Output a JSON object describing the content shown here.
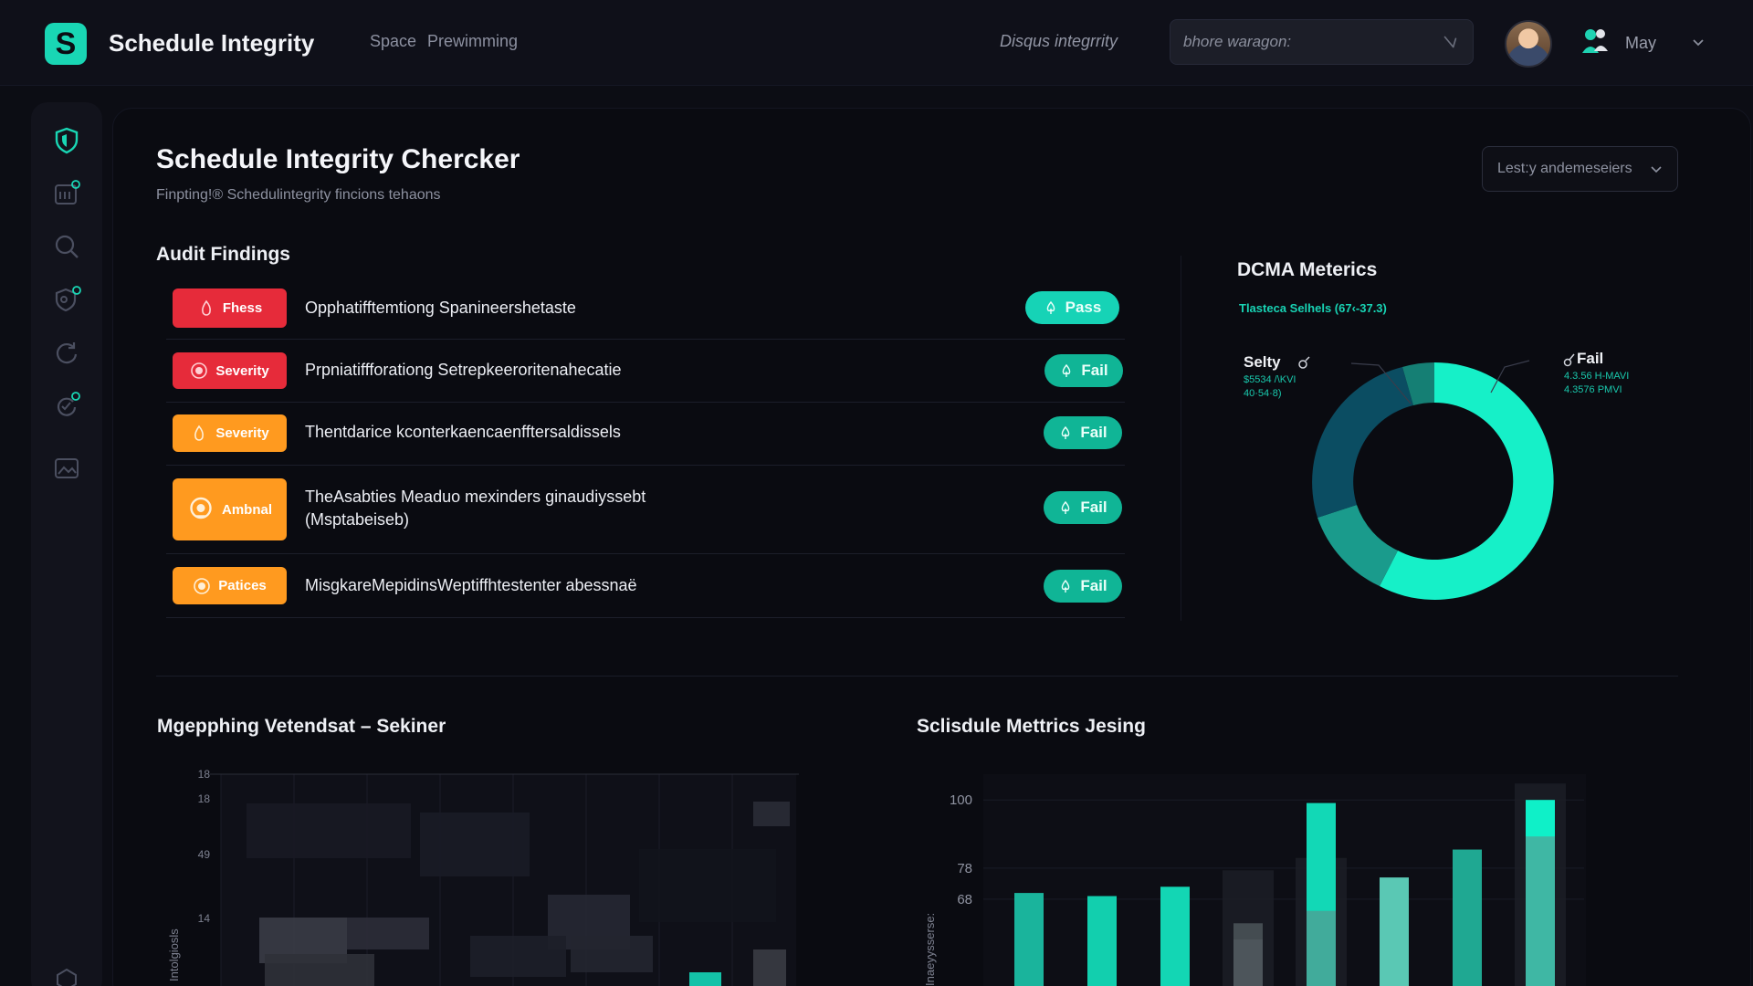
{
  "header": {
    "logo_letter": "S",
    "app_title": "Schedule Integrity",
    "nav": [
      "Space",
      "Prewimming"
    ],
    "top_link": "Disqus integrrity",
    "search_placeholder": "bhore waragon:",
    "user_name": "May"
  },
  "page": {
    "title": "Schedule Integrity Chercker",
    "subtitle": "Finpting!® Schedulintegrity fincions tehaons",
    "filter_label": "Lest:y andemeseiers"
  },
  "audit": {
    "title": "Audit Findings",
    "findings": [
      {
        "severity": "Fhess",
        "severity_color": "#e62b3a",
        "text_lines": [
          "Opphatifftemtiong Spanineershetaste"
        ],
        "status": "Pass"
      },
      {
        "severity": "Severity",
        "severity_color": "#e62b3a",
        "text_lines": [
          "Prpniatiffforationg Setrepkeeroritenahecatie"
        ],
        "status": "Fail"
      },
      {
        "severity": "Severity",
        "severity_color": "#ff9a1f",
        "text_lines": [
          "Thentdarice kconterkaencaenfftersaldissels"
        ],
        "status": "Fail"
      },
      {
        "severity": "Ambnal",
        "severity_color": "#ff9a1f",
        "text_lines": [
          "TheAsabties Meaduo mexinders ginaudiyssebt",
          "(Msptabeiseb)"
        ],
        "status": "Fail"
      },
      {
        "severity": "Patices",
        "severity_color": "#ff9a1f",
        "text_lines": [
          "MisgkareMepidinsWeptiffhtestenter abessnaë"
        ],
        "status": "Fail"
      }
    ]
  },
  "dcma": {
    "title": "DCMA Meterics",
    "subtitle": "Tlasteca Selhels (67‹-37.3)",
    "legend": [
      {
        "label": "Selty",
        "lines": [
          "$5534 /\\KVI",
          "40·54·8)"
        ]
      },
      {
        "label": "Fail",
        "lines": [
          "4.3.56 H-MAVI",
          "4.3576 PMVI"
        ]
      }
    ],
    "colors": {
      "fail": "#16f0c8",
      "selty": "#0b4d62",
      "third": "#1a9b8c",
      "fourth": "#2fc6a8"
    }
  },
  "chart_data": [
    {
      "type": "heatmap",
      "title": "Mgepphing Vetendsat  –  Sekiner",
      "ylabel": "Intolgiosls",
      "y_ticks": [
        "18",
        "18",
        "49",
        "14"
      ]
    },
    {
      "type": "bar",
      "title": "Sclisdule Mettrics Jesing",
      "ylabel": "Inaeyysserse:",
      "y_ticks": [
        100,
        78,
        68
      ],
      "series": [
        {
          "values": [
            70,
            69,
            72,
            55,
            99,
            75,
            84,
            100
          ]
        },
        {
          "values": [
            0,
            0,
            0,
            72,
            76,
            0,
            0,
            100
          ]
        }
      ]
    }
  ]
}
